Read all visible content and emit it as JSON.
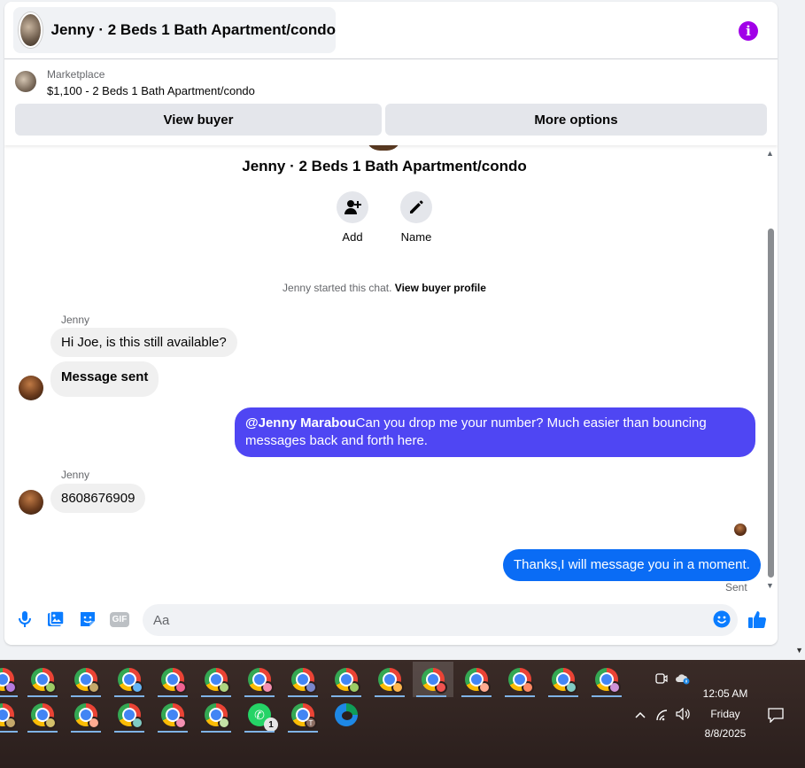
{
  "header": {
    "title": "Jenny · 2 Beds 1 Bath Apartment/condo",
    "info_glyph": "i"
  },
  "marketplace": {
    "label": "Marketplace",
    "listing": "$1,100 - 2 Beds 1 Bath Apartment/condo",
    "view_buyer": "View buyer",
    "more_options": "More options"
  },
  "thread": {
    "title": "Jenny · 2 Beds 1 Bath Apartment/condo",
    "actions": [
      {
        "label": "Add",
        "icon": "add-person-icon"
      },
      {
        "label": "Name",
        "icon": "pencil-icon"
      }
    ],
    "started_text": "Jenny started this chat.",
    "started_link": "View buyer profile"
  },
  "messages": {
    "sender_1": "Jenny",
    "m1": "Hi Joe, is this still available?",
    "m2": "Message sent",
    "m3_mention": "@Jenny Marabou",
    "m3_text": "Can you drop me your number? Much easier than bouncing messages back and forth here.",
    "sender_2": "Jenny",
    "m4": "8608676909",
    "m5": "Thanks,I will message you in a moment.",
    "status": "Sent"
  },
  "composer": {
    "placeholder": "Aa",
    "icons": [
      "microphone-icon",
      "photo-icon",
      "sticker-icon",
      "gif-icon",
      "emoji-icon",
      "thumbs-up-icon"
    ],
    "gif_label": "GIF"
  },
  "taskbar": {
    "whatsapp_badge": "1",
    "profile_letter": "T",
    "clock_time": "12:05 AM",
    "clock_day": "Friday",
    "clock_date": "8/8/2025"
  },
  "colors": {
    "accent_purple": "#a100e8",
    "bubble_outgoing": "#4f46f3",
    "bubble_outgoing_blue": "#0a6cf5",
    "messenger_blue": "#0a7cff"
  }
}
